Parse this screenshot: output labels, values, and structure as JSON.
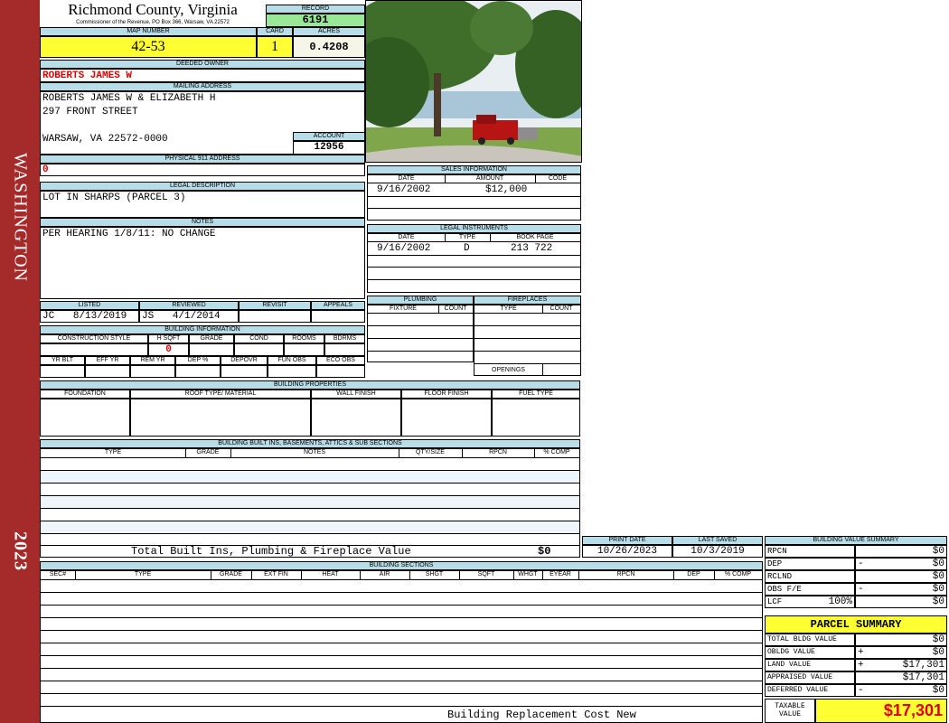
{
  "sidebar": {
    "district": "WASHINGTON",
    "year": "2023"
  },
  "header": {
    "county": "Richmond County, Virginia",
    "address": "Commissioner of the Revenue, PO Box 366, Warsaw, VA 22572",
    "record_label": "RECORD",
    "record": "6191",
    "map_label": "MAP NUMBER",
    "map_number": "42-53",
    "card_label": "CARD",
    "card": "1",
    "acres_label": "ACRES",
    "acres": "0.4208"
  },
  "owner": {
    "deeded_label": "DEEDED OWNER",
    "deeded_owner": "ROBERTS JAMES W",
    "mailing_label": "MAILING ADDRESS",
    "mailing_line1": "ROBERTS JAMES W & ELIZABETH H",
    "mailing_line2": "297 FRONT STREET",
    "mailing_line3": "WARSAW, VA 22572-0000",
    "account_label": "ACCOUNT",
    "account": "12956",
    "physical_label": "PHYSICAL 911 ADDRESS",
    "physical": "0",
    "legal_label": "LEGAL DESCRIPTION",
    "legal": "LOT IN SHARPS (PARCEL 3)",
    "notes_label": "NOTES",
    "notes": "PER HEARING 1/8/11: NO CHANGE"
  },
  "review": {
    "listed_label": "LISTED",
    "listed_by": "JC",
    "listed_date": "8/13/2019",
    "reviewed_label": "REVIEWED",
    "reviewed_by": "JS",
    "reviewed_date": "4/1/2014",
    "revisit_label": "REVISIT",
    "appeals_label": "APPEALS"
  },
  "building_info": {
    "title": "BUILDING INFORMATION",
    "headers1": [
      "CONSTRUCTION STYLE",
      "H SQFT",
      "GRADE",
      "COND",
      "ROOMS",
      "BDRMS"
    ],
    "hsqft": "0",
    "headers2": [
      "YR BLT",
      "EFF YR",
      "REM YR",
      "DEP %",
      "DEPOVR",
      "FUN OBS",
      "ECO OBS"
    ]
  },
  "sales": {
    "title": "SALES INFORMATION",
    "headers": [
      "DATE",
      "AMOUNT",
      "CODE"
    ],
    "date": "9/16/2002",
    "amount": "$12,000"
  },
  "legal_instruments": {
    "title": "LEGAL INSTRUMENTS",
    "headers": [
      "DATE",
      "TYPE",
      "BOOK PAGE"
    ],
    "date": "9/16/2002",
    "type": "D",
    "book": "213 722"
  },
  "plumbing": {
    "title": "PLUMBING",
    "fixture": "FIXTURE",
    "count": "COUNT"
  },
  "fireplaces": {
    "title": "FIREPLACES",
    "type": "TYPE",
    "count": "COUNT",
    "openings": "OPENINGS"
  },
  "properties": {
    "title": "BUILDING PROPERTIES",
    "headers": [
      "FOUNDATION",
      "ROOF TYPE/ MATERIAL",
      "WALL FINISH",
      "FLOOR FINISH",
      "FUEL TYPE"
    ]
  },
  "builtins": {
    "title": "BUILDING BUILT INS, BASEMENTS, ATTICS & SUB SECTIONS",
    "headers": [
      "TYPE",
      "GRADE",
      "NOTES",
      "QTY/SIZE",
      "RPCN",
      "% COMP"
    ],
    "total_label": "Total Built Ins, Plumbing & Fireplace Value",
    "total": "$0"
  },
  "dates": {
    "print_label": "PRINT DATE",
    "print_date": "10/26/2023",
    "saved_label": "LAST SAVED",
    "saved_date": "10/3/2019"
  },
  "sections": {
    "title": "BUILDING SECTIONS",
    "headers": [
      "SEC#",
      "TYPE",
      "GRADE",
      "EXT FIN",
      "HEAT",
      "AIR",
      "SHGT",
      "SQFT",
      "WHGT",
      "EYEAR",
      "RPCN",
      "DEP",
      "% COMP"
    ],
    "footer": "Building Replacement Cost New"
  },
  "bvs": {
    "title": "BUILDING VALUE SUMMARY",
    "rows": [
      {
        "label": "RPCN",
        "sign": "",
        "value": "$0"
      },
      {
        "label": "DEP",
        "sign": "-",
        "value": "$0"
      },
      {
        "label": "RCLND",
        "sign": "",
        "value": "$0"
      },
      {
        "label": "OBS F/E",
        "sign": "-",
        "value": "$0"
      },
      {
        "label": "LCF",
        "extra": "100%",
        "sign": "",
        "value": "$0"
      }
    ]
  },
  "parcel": {
    "title": "PARCEL SUMMARY",
    "rows": [
      {
        "label": "TOTAL BLDG VALUE",
        "sign": "",
        "value": "$0"
      },
      {
        "label": "OBLDG VALUE",
        "sign": "+",
        "value": "$0"
      },
      {
        "label": "LAND VALUE",
        "sign": "+",
        "value": "$17,301"
      },
      {
        "label": "APPRAISED VALUE",
        "sign": "",
        "value": "$17,301"
      },
      {
        "label": "DEFERRED VALUE",
        "sign": "-",
        "value": "$0"
      }
    ],
    "taxable_label": "TAXABLE VALUE",
    "taxable": "$17,301"
  }
}
